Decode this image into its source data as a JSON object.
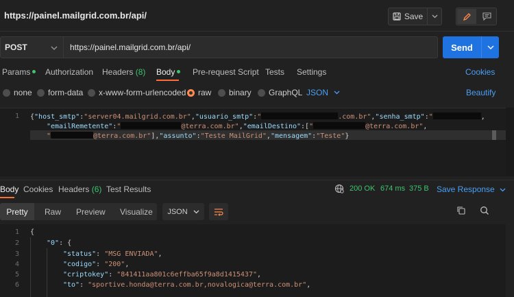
{
  "window": {
    "title": "https://painel.mailgrid.com.br/api/",
    "save_label": "Save"
  },
  "request": {
    "method": "POST",
    "url": "https://painel.mailgrid.com.br/api/",
    "send_label": "Send",
    "tabs": {
      "params": "Params",
      "authorization": "Authorization",
      "headers": "Headers",
      "headers_count": "(8)",
      "body": "Body",
      "prerequest": "Pre-request Script",
      "tests": "Tests",
      "settings": "Settings"
    },
    "cookies_label": "Cookies",
    "body_types": {
      "none": "none",
      "form_data": "form-data",
      "urlencoded": "x-www-form-urlencoded",
      "raw": "raw",
      "binary": "binary",
      "graphql": "GraphQL"
    },
    "raw_format": "JSON",
    "beautify_label": "Beautify",
    "body_lines": {
      "ln1": "1",
      "k_host": "\"host_smtp\"",
      "v_host": "\"server04.mailgrid.com.br\"",
      "k_usuario": "\"usuario_smtp\"",
      "v_usuario_end": ".com.br\"",
      "k_senha": "\"senha_smtp\"",
      "k_remetente": "\"emailRemetente\"",
      "v_remetente_end": "@terra.com.br\"",
      "k_destino": "\"emailDestino\"",
      "v_destino1_end": "@terra.com.br\"",
      "v_destino2_end": "@terra.com.br\"",
      "k_assunto": "\"assunto\"",
      "v_assunto": "\"Teste MailGrid\"",
      "k_mensagem": "\"mensagem\"",
      "v_mensagem": "\"Teste\""
    }
  },
  "response": {
    "tabs": {
      "body": "Body",
      "cookies": "Cookies",
      "headers": "Headers",
      "headers_count": "(6)",
      "test_results": "Test Results"
    },
    "status": "200 OK",
    "time": "674 ms",
    "size": "375 B",
    "save_response": "Save Response",
    "views": {
      "pretty": "Pretty",
      "raw": "Raw",
      "preview": "Preview",
      "visualize": "Visualize"
    },
    "format": "JSON",
    "lines": {
      "n1": "1",
      "n2": "2",
      "n3": "3",
      "n4": "4",
      "n5": "5",
      "n6": "6",
      "l1": "{",
      "k0": "\"0\"",
      "brace": "{",
      "k_status": "\"status\"",
      "v_status": "\"MSG ENVIADA\"",
      "k_codigo": "\"codigo\"",
      "v_codigo": "\"200\"",
      "k_cripto": "\"criptokey\"",
      "v_cripto": "\"841411aa801c6effba65f9a8d1415437\"",
      "k_to": "\"to\"",
      "v_to": "\"sportive.honda@terra.com.br,novalogica@terra.com.br\""
    }
  },
  "colors": {
    "accent_blue": "#1f73e0",
    "active_orange": "#ff6c37",
    "success_green": "#3ec46d",
    "link_blue": "#4a9ff5"
  }
}
